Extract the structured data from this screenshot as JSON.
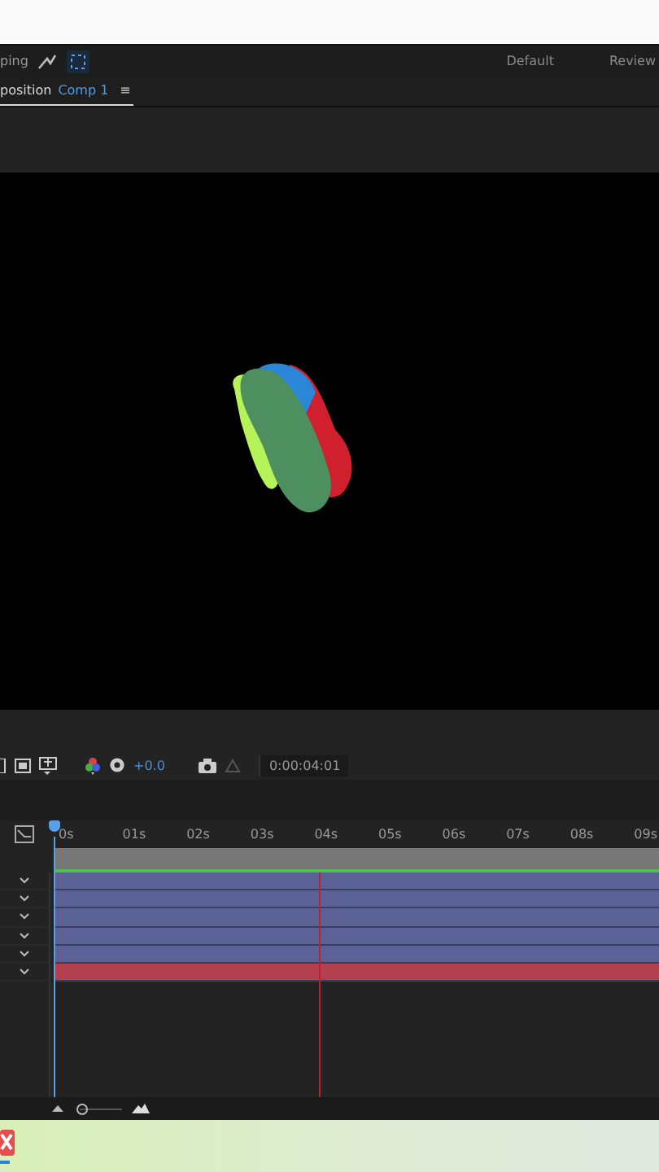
{
  "workspace_bar": {
    "panel_label": "ping",
    "workspaces": [
      {
        "label": "Default",
        "selected": false
      },
      {
        "label": "Review",
        "selected": false
      }
    ]
  },
  "panel_tab": {
    "title": "position",
    "comp": "Comp 1",
    "menu": "≡"
  },
  "viewer_toolbar": {
    "exposure": "+0.0",
    "timecode": "0:00:04:01"
  },
  "timeline": {
    "zoom": {
      "level": 0.1
    },
    "ruler": [
      "0s",
      "01s",
      "02s",
      "03s",
      "04s",
      "05s",
      "06s",
      "07s",
      "08s",
      "09s"
    ],
    "layers": [
      {
        "color": "#5b6095"
      },
      {
        "color": "#5b6095"
      },
      {
        "color": "#5b6095"
      },
      {
        "color": "#5b6095"
      },
      {
        "color": "#5b6095"
      },
      {
        "color": "#b2404f"
      }
    ]
  }
}
